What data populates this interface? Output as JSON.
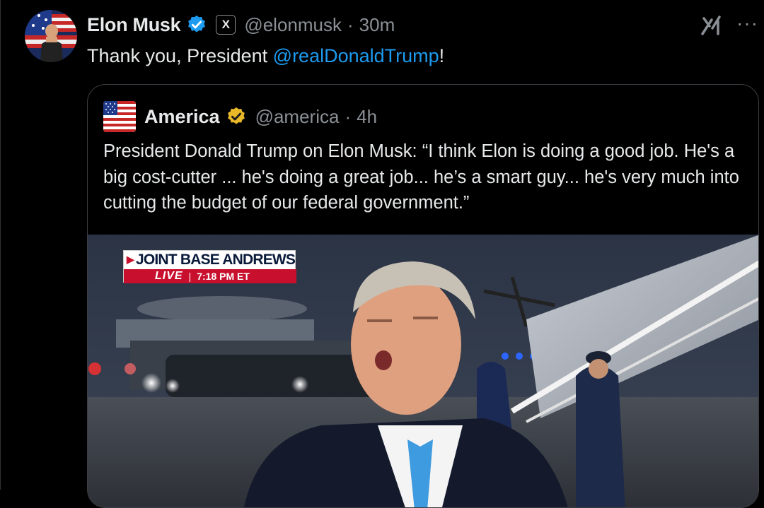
{
  "tweet": {
    "author_name": "Elon Musk",
    "author_handle": "@elonmusk",
    "separator": "·",
    "time": "30m",
    "x_badge": "X",
    "text_prefix": "Thank you, President ",
    "mention": "@realDonaldTrump",
    "text_suffix": "!",
    "icons": {
      "avatar": "avatar",
      "verified": "verified-badge-icon",
      "grok": "grok-icon",
      "more": "more-options-icon"
    }
  },
  "quote": {
    "author_name": "America",
    "author_handle": "@america",
    "separator": "·",
    "time": "4h",
    "text": "President Donald Trump on Elon Musk: “I think Elon is doing a good job. He's a big cost-cutter ... he's doing a great job... he’s a smart guy... he's very much into cutting the budget of our federal government.”",
    "media": {
      "chyron_location": "JOINT BASE ANDREWS",
      "chyron_live": "LIVE",
      "chyron_separator": "|",
      "chyron_time": "7:18 PM ET"
    }
  },
  "colors": {
    "background": "#000000",
    "text": "#e7e9ea",
    "secondary": "#8b9096",
    "mention": "#1d9bf0",
    "verified_blue": "#1d9bf0",
    "verified_gold": "#e8b829",
    "chyron_red": "#c8102e"
  }
}
